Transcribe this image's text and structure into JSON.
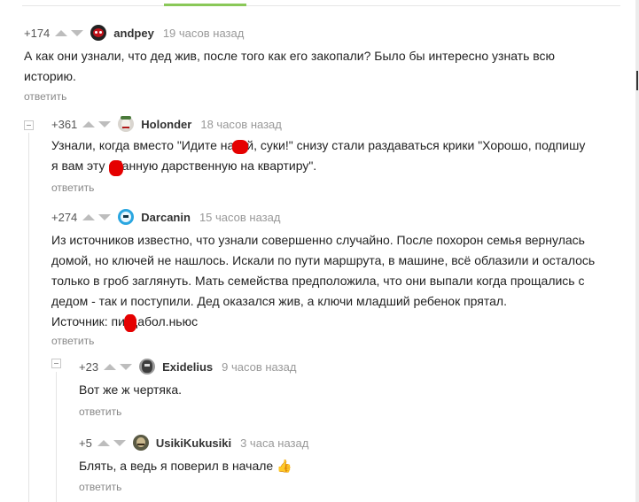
{
  "comments": [
    {
      "rating": "+174",
      "author": "andpey",
      "time": "19 часов назад",
      "lines": [
        "А как они узнали, что дед жив, после того как его закопали? Было бы интересно узнать всю",
        "историю."
      ],
      "reply": "ответить"
    },
    {
      "rating": "+361",
      "author": "Holonder",
      "time": "18 часов назад",
      "lines": [
        "Узнали, когда вместо \"Идите нахуй, суки!\" снизу стали раздаваться крики \"Хорошо, подпишу",
        "я вам эту ебанную дарственную на квартиру\"."
      ],
      "reply": "ответить"
    },
    {
      "rating": "+274",
      "author": "Darcanin",
      "time": "15 часов назад",
      "lines": [
        "Из источников известно, что узнали совершенно случайно. После похорон семья вернулась",
        "домой, но ключей не нашлось. Искали по пути маршрута, в машине, всё облазили и осталось",
        "только в гроб заглянуть. Мать семейства предположила, что они выпали когда прощались с",
        "дедом - так и поступили. Дед оказался жив, а ключи младший ребенок прятал.",
        "Источник: пиздабол.ньюс"
      ],
      "reply": "ответить"
    },
    {
      "rating": "+23",
      "author": "Exidelius",
      "time": "9 часов назад",
      "lines": [
        "Вот же ж чертяка."
      ],
      "reply": "ответить"
    },
    {
      "rating": "+5",
      "author": "UsikiKukusiki",
      "time": "3 часа назад",
      "lines": [
        "Блять, а ведь я поверил в начале 👍"
      ],
      "reply": "ответить"
    }
  ],
  "colors": {
    "accent_green": "#8ac858",
    "censor_red": "#e50000",
    "vote_arrow": "#bdbdbd"
  },
  "icons": {
    "upvote": "arrow-up-icon",
    "downvote": "arrow-down-icon",
    "collapse": "minus-square-icon",
    "thumbs_up": "thumbs-up-emoji"
  }
}
